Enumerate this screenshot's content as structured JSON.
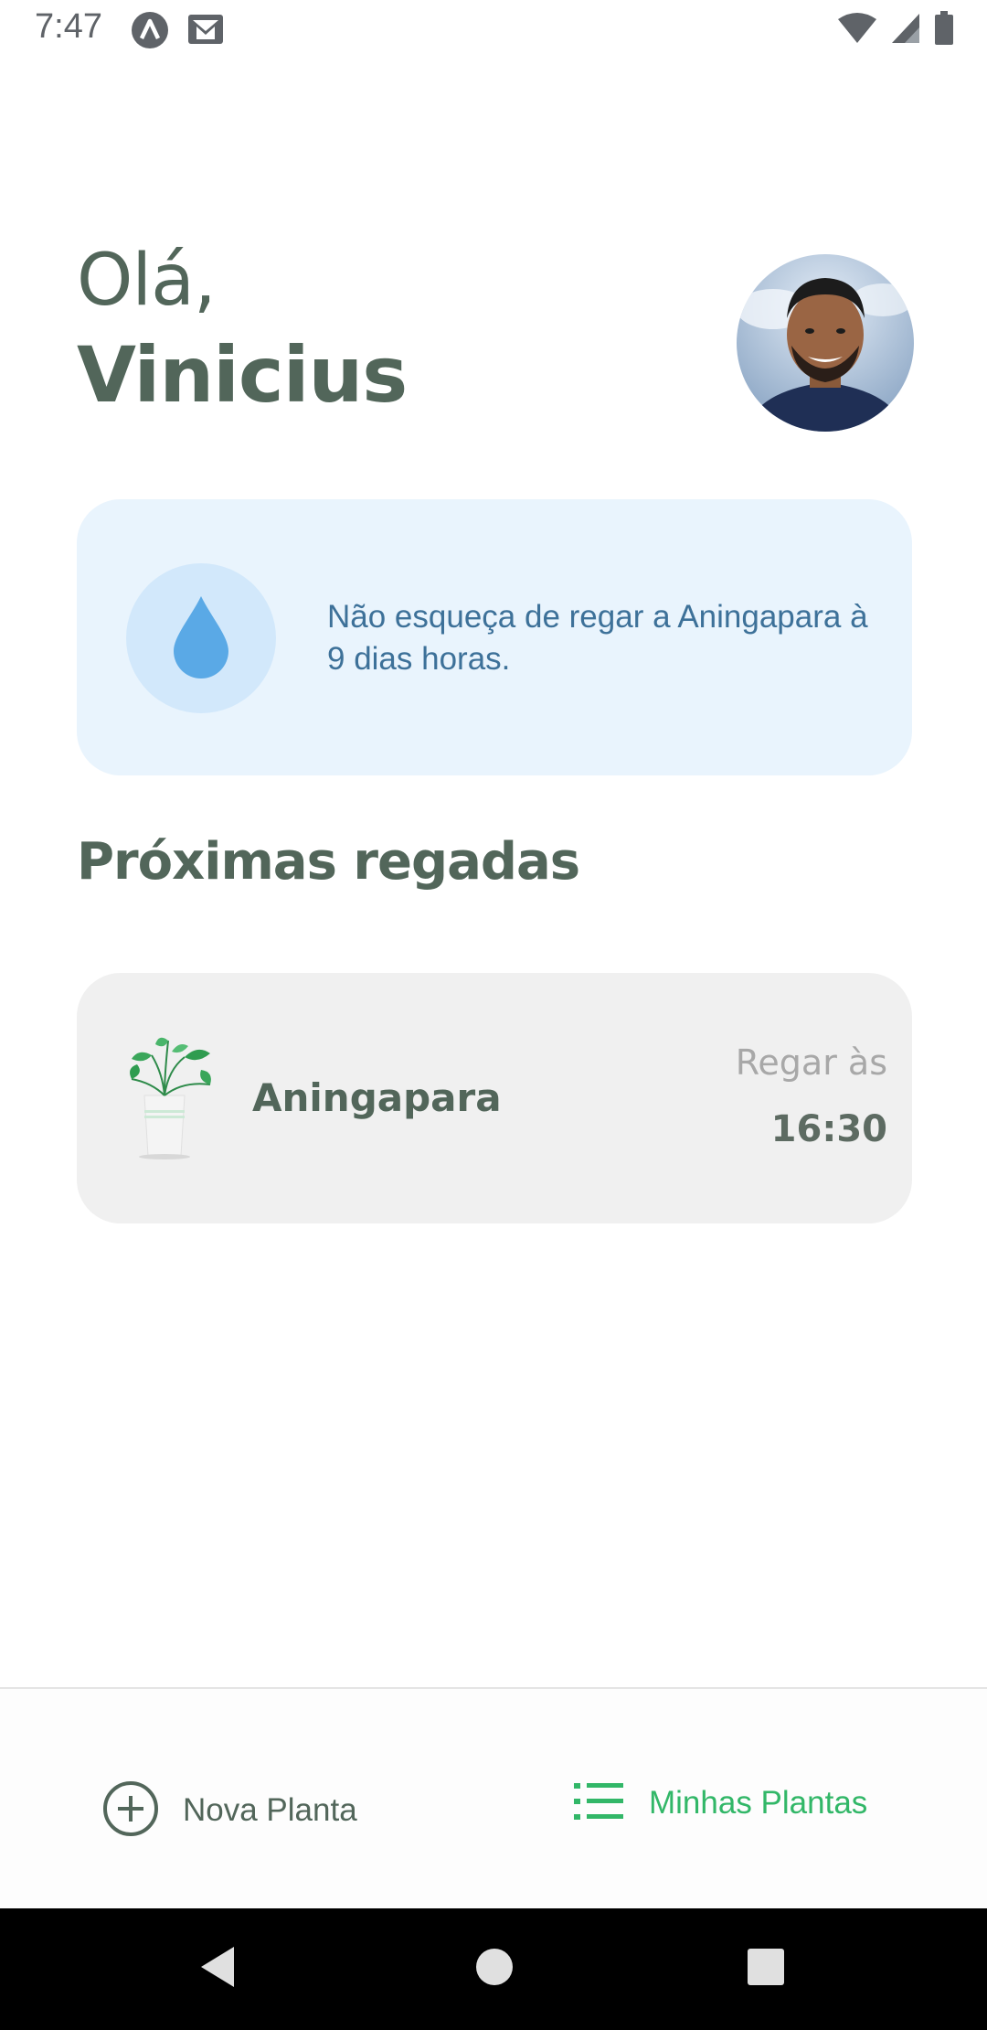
{
  "status_bar": {
    "time": "7:47",
    "left_icons": [
      "app-notification-icon",
      "gmail-icon"
    ],
    "right_icons": [
      "wifi-icon",
      "cell-signal-icon",
      "battery-icon"
    ]
  },
  "header": {
    "greeting": "Olá,",
    "user_name": "Vinicius",
    "avatar": "user-avatar-photo"
  },
  "reminder": {
    "icon": "water-drop-icon",
    "text": "Não esqueça de regar a Aningapara à 9 dias horas."
  },
  "section": {
    "title": "Próximas regadas"
  },
  "plants": [
    {
      "name": "Aningapara",
      "water_label": "Regar às",
      "water_time": "16:30",
      "image": "potted-plant-illustration"
    }
  ],
  "bottom_nav": {
    "new_plant": {
      "label": "Nova Planta",
      "icon": "plus-circle-icon"
    },
    "my_plants": {
      "label": "Minhas Plantas",
      "icon": "list-icon",
      "active": true
    }
  },
  "system_nav": {
    "back": "back-icon",
    "home": "home-icon",
    "recents": "recents-icon"
  },
  "colors": {
    "heading": "#52665a",
    "reminder_bg": "#e9f4fd",
    "reminder_text": "#3d7199",
    "drop": "#5aa9e6",
    "card_bg": "#f0f0f0",
    "accent_green": "#32b768",
    "muted_label": "#a8a8a8"
  }
}
